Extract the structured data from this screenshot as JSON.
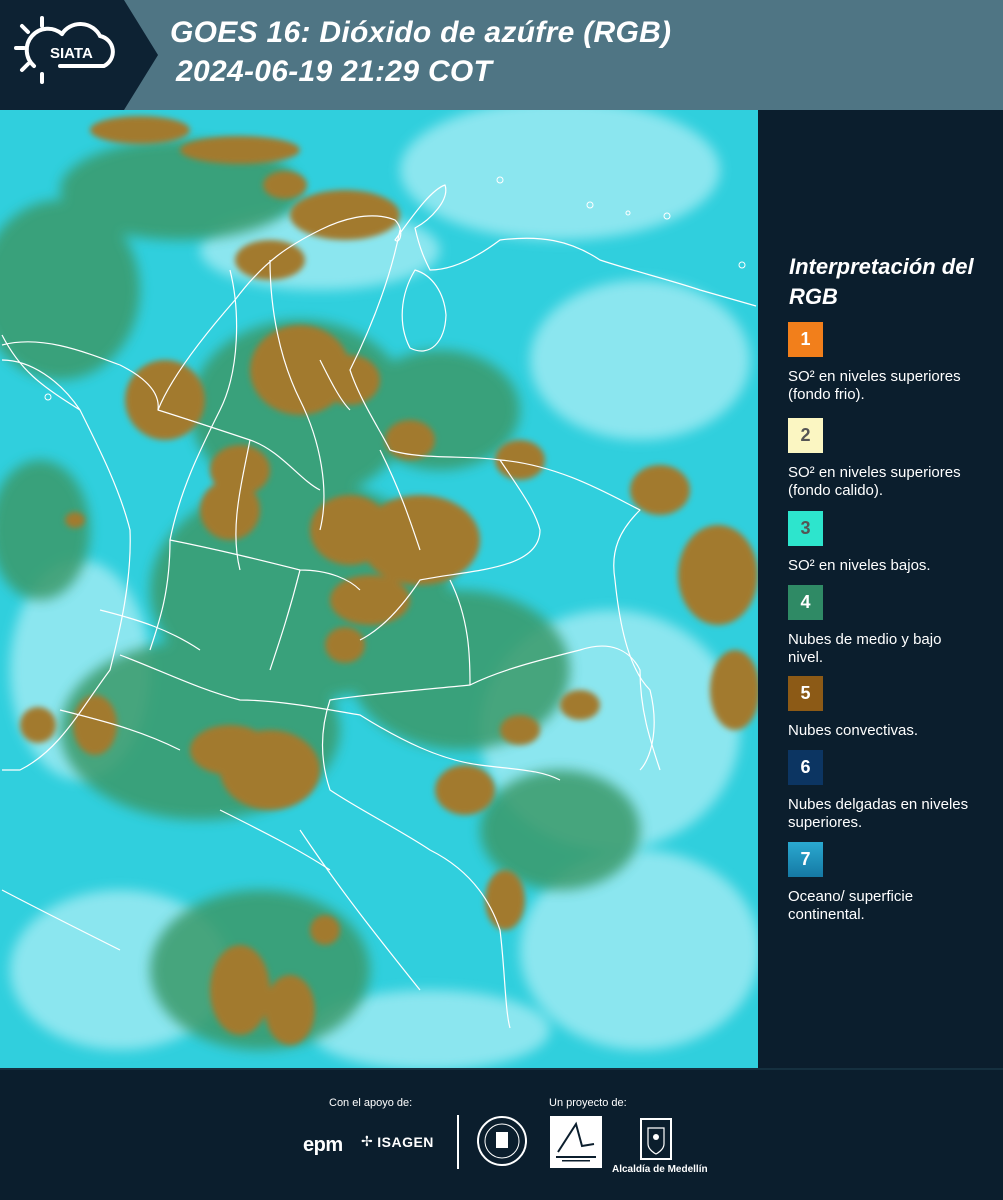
{
  "header": {
    "title_line1": "GOES 16: Dióxido de azúfre (RGB)",
    "title_line2": "2024-06-19 21:29 COT",
    "logo_text": "SIATA"
  },
  "legend": {
    "title": "Interpretación del RGB",
    "items": [
      {
        "number": "1",
        "color": "#f27f1b",
        "num_color": "#ffffff",
        "text": "SO² en niveles superiores (fondo frio)."
      },
      {
        "number": "2",
        "color": "#fbf6c2",
        "num_color": "#555555",
        "text": "SO² en niveles superiores (fondo calido)."
      },
      {
        "number": "3",
        "color": "#2de5cd",
        "num_color": "#555555",
        "text": "SO² en niveles bajos."
      },
      {
        "number": "4",
        "color": "#2f8a65",
        "num_color": "#ffffff",
        "text": "Nubes de medio y bajo nivel."
      },
      {
        "number": "5",
        "color": "#8c5a16",
        "num_color": "#ffffff",
        "text": "Nubes convectivas."
      },
      {
        "number": "6",
        "color": "#0c3562",
        "num_color": "#ffffff",
        "text": "Nubes delgadas en niveles superiores."
      },
      {
        "number": "7",
        "color": "#1a8bb6",
        "num_color": "#ffffff",
        "text": "Oceano/ superficie continental."
      }
    ]
  },
  "map": {
    "colors": {
      "background": "#2fd0de",
      "cloud_free": "#aef0f6",
      "low_cloud": "#3a9a6a",
      "convective": "#9a7a2c",
      "boundary": "#ffffff"
    }
  },
  "footer": {
    "support_label": "Con el apoyo de:",
    "project_label": "Un proyecto de:",
    "epm": "epm",
    "isagen": "ISAGEN",
    "alcaldia": "Alcaldía de Medellín"
  }
}
